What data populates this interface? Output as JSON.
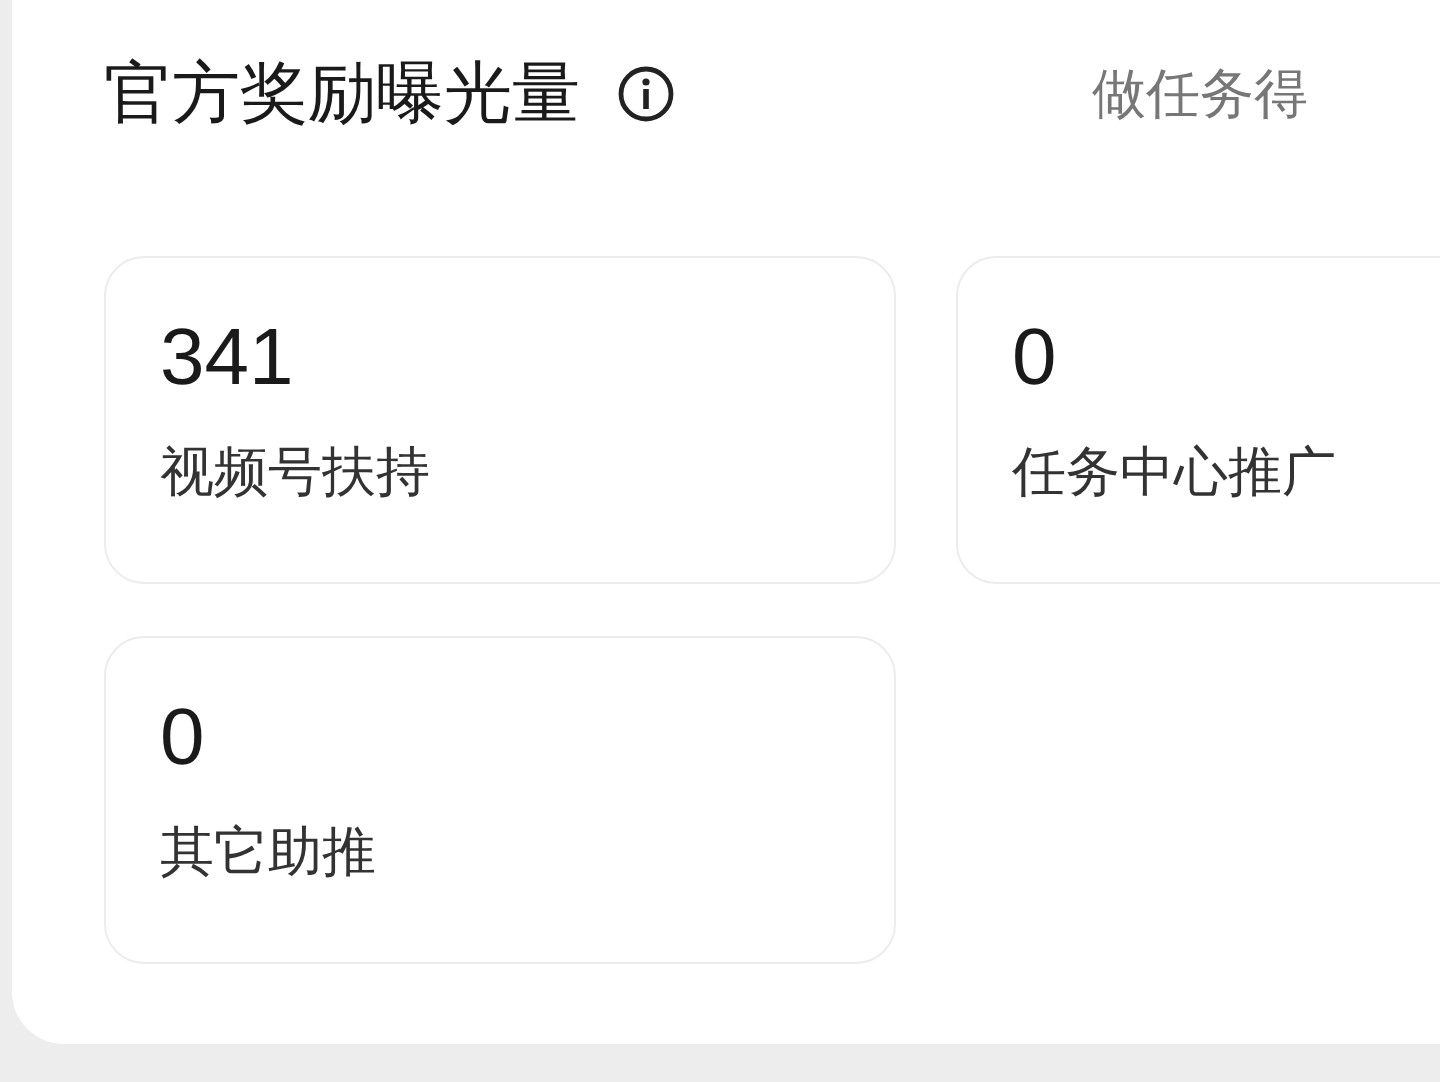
{
  "header": {
    "title": "官方奖励曝光量",
    "link": "做任务得"
  },
  "stats": [
    {
      "value": "341",
      "label": "视频号扶持"
    },
    {
      "value": "0",
      "label": "任务中心推广"
    },
    {
      "value": "0",
      "label": "其它助推"
    }
  ]
}
